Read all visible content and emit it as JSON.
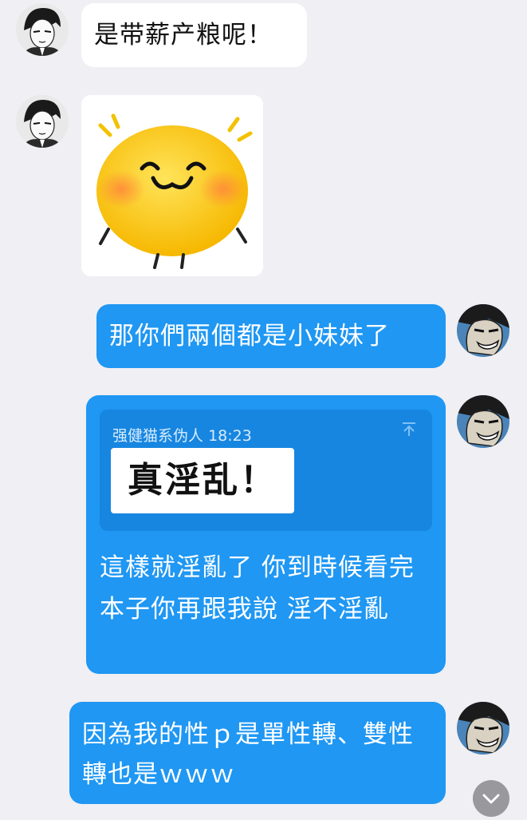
{
  "messages": [
    {
      "side": "in",
      "type": "text",
      "text": "是带薪产粮呢！"
    },
    {
      "side": "in",
      "type": "sticker",
      "sticker": "shy-emoji-sticker"
    },
    {
      "side": "out",
      "type": "text",
      "text": "那你們兩個都是小妹妹了"
    },
    {
      "side": "out",
      "type": "reply",
      "quote": {
        "sender": "强健猫系伪人",
        "time": "18:23",
        "content": "真淫乱！"
      },
      "text": "這樣就淫亂了 你到時候看完本子你再跟我說 淫不淫亂"
    },
    {
      "side": "out",
      "type": "text",
      "text": "因為我的性ｐ是單性轉、雙性轉也是ｗｗｗ"
    }
  ],
  "colors": {
    "background": "#efeff4",
    "incoming_bubble": "#ffffff",
    "outgoing_bubble": "#1f97f3",
    "quote_box": "#1786e0"
  },
  "icons": {
    "quote": "pin-top-icon",
    "scroll": "chevron-down-icon"
  }
}
